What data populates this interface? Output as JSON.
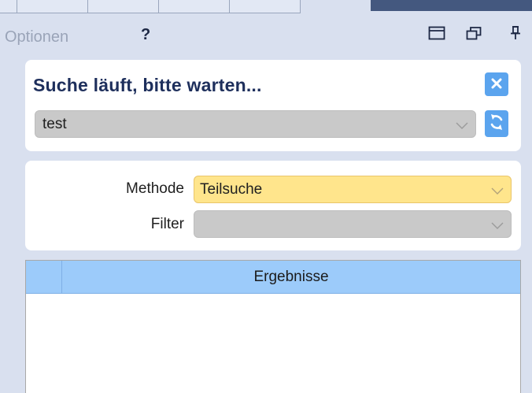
{
  "header": {
    "options_label": "Optionen",
    "help_label": "?",
    "icons": [
      "window-icon",
      "restore-window-icon",
      "pin-icon"
    ]
  },
  "search": {
    "status_text": "Suche läuft, bitte warten...",
    "query_value": "test",
    "close_icon": "close-icon",
    "refresh_icon": "refresh-icon"
  },
  "options": {
    "method_label": "Methode",
    "method_value": "Teilsuche",
    "filter_label": "Filter",
    "filter_value": ""
  },
  "results": {
    "column_header": "Ergebnisse",
    "rows": []
  },
  "colors": {
    "accent": "#5ba4ee",
    "highlight_field": "#ffe58c",
    "table_header": "#9ccbfa",
    "title_text": "#1e2f5c",
    "active_tab": "#44587f"
  }
}
